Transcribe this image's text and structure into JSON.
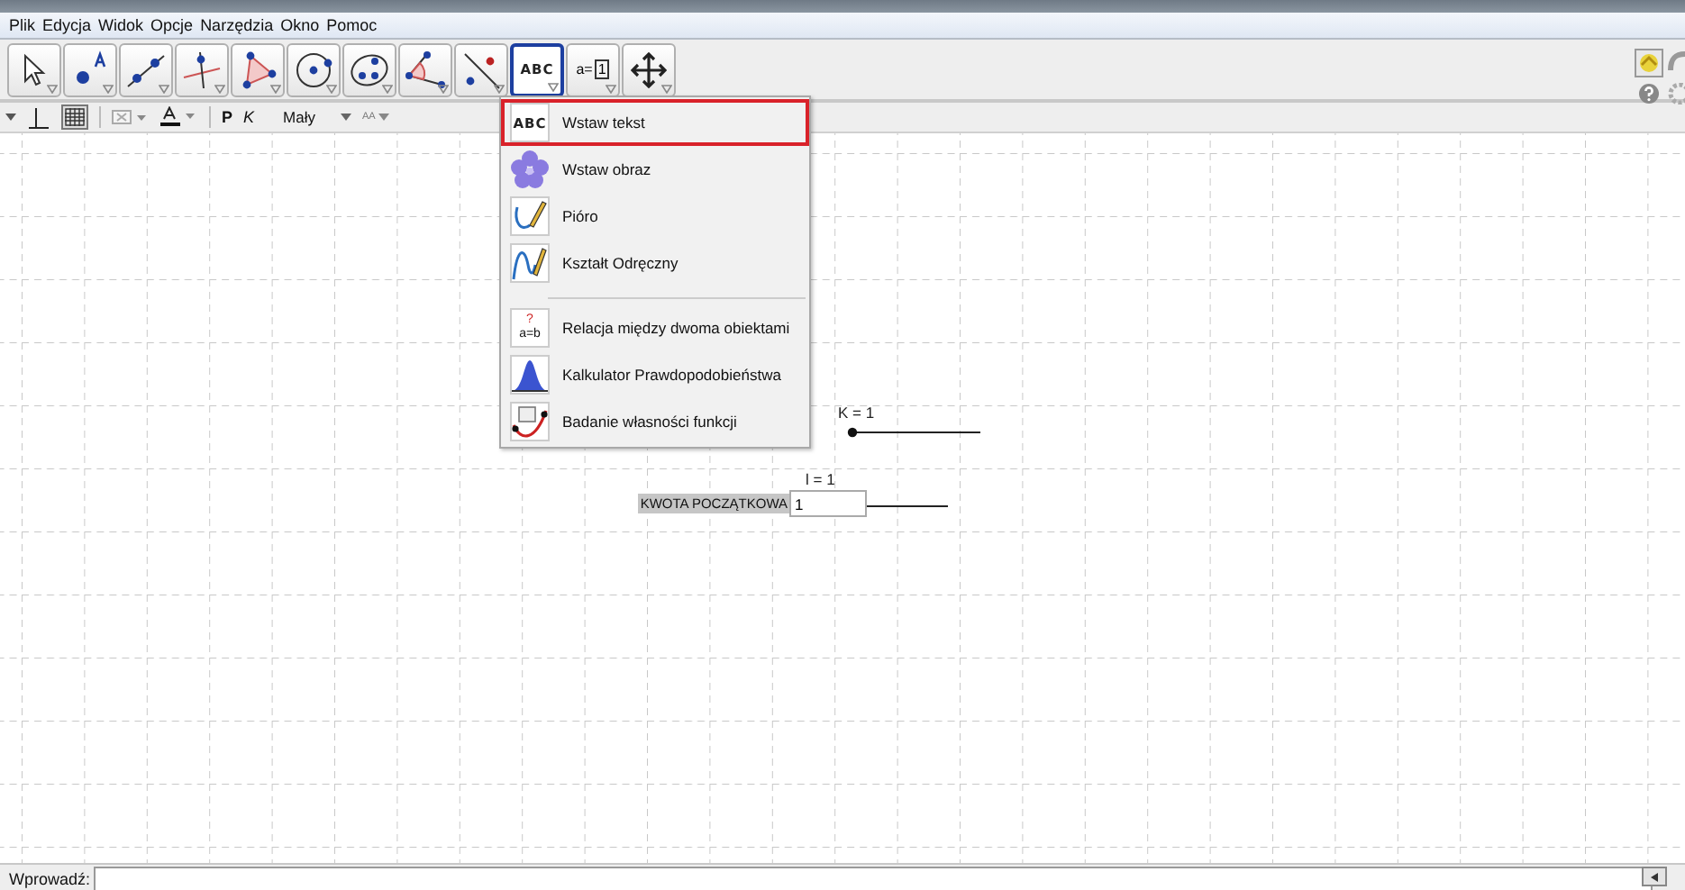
{
  "menu": [
    {
      "label": "Plik"
    },
    {
      "label": "Edycja"
    },
    {
      "label": "Widok"
    },
    {
      "label": "Opcje"
    },
    {
      "label": "Narzędzia"
    },
    {
      "label": "Okno"
    },
    {
      "label": "Pomoc"
    }
  ],
  "toolbar": [
    {
      "kind": "move",
      "selected": false
    },
    {
      "kind": "point",
      "selected": false
    },
    {
      "kind": "line",
      "selected": false
    },
    {
      "kind": "perpendicular",
      "selected": false
    },
    {
      "kind": "polygon",
      "selected": false
    },
    {
      "kind": "circle",
      "selected": false
    },
    {
      "kind": "conic",
      "selected": false
    },
    {
      "kind": "angle",
      "selected": false
    },
    {
      "kind": "reflect",
      "selected": false
    },
    {
      "kind": "text",
      "selected": true,
      "text": "ABC"
    },
    {
      "kind": "slider",
      "selected": false,
      "text": "a=",
      "value": "1"
    },
    {
      "kind": "move-view",
      "selected": false
    }
  ],
  "style_bar": {
    "grid_on": true,
    "bold": "P",
    "italic": "K",
    "size": "Mały",
    "size_icon": "AA"
  },
  "tool_menu": {
    "groups": [
      [
        {
          "kind": "text",
          "icon_text": "ABC",
          "label": "Wstaw tekst",
          "selected": true
        },
        {
          "kind": "image",
          "label": "Wstaw obraz",
          "selected": false
        },
        {
          "kind": "pen",
          "label": "Pióro",
          "selected": false
        },
        {
          "kind": "freehand",
          "label": "Kształt Odręczny",
          "selected": false
        }
      ],
      [
        {
          "kind": "relation",
          "icon_text": "?",
          "icon_text_2": "a=b",
          "label": "Relacja między dwoma obiektami",
          "selected": false
        },
        {
          "kind": "probability",
          "label": "Kalkulator Prawdopodobieństwa",
          "selected": false
        },
        {
          "kind": "function",
          "label": "Badanie własności funkcji",
          "selected": false
        }
      ]
    ]
  },
  "canvas": {
    "sliders": [
      {
        "label": "K = 1",
        "level": 0
      },
      {
        "label": "l = 1"
      }
    ],
    "input_box": {
      "label": "KWOTA POCZĄTKOWA",
      "value": "1"
    }
  },
  "input_bar": {
    "label": "Wprowadź:"
  }
}
